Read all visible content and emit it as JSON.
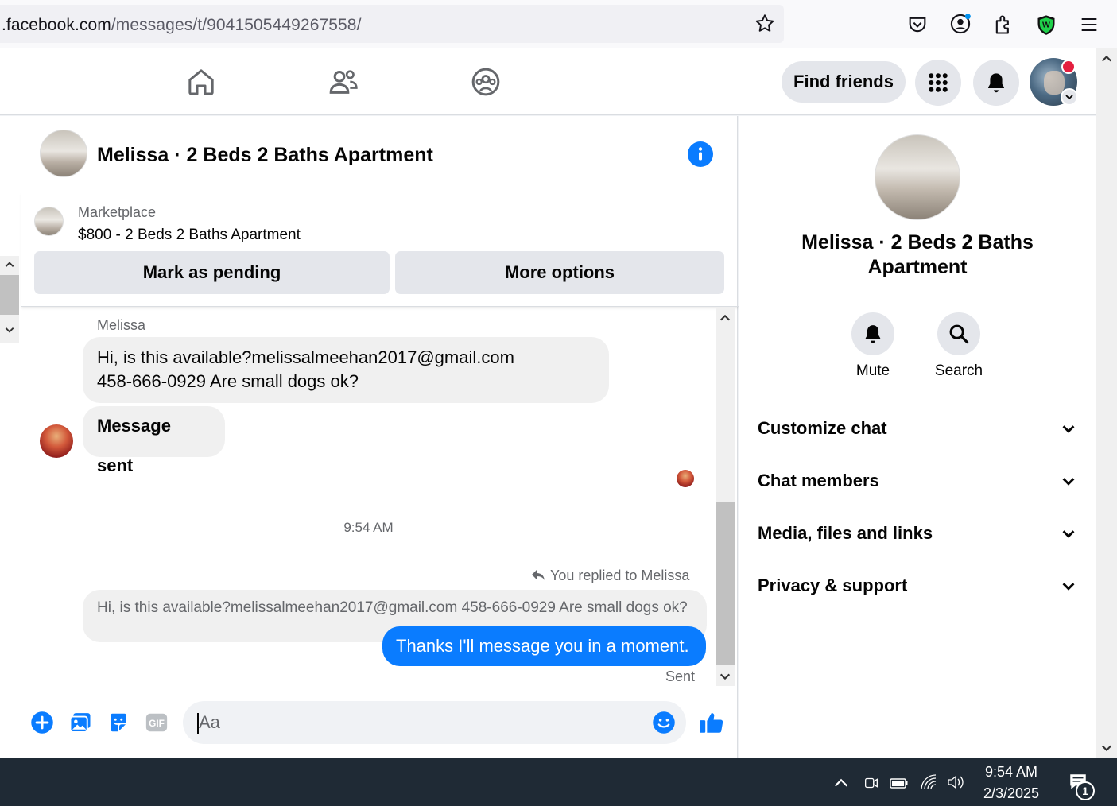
{
  "browser": {
    "url_host": ".facebook.com",
    "url_path": "/messages/t/9041505449267558/"
  },
  "nav": {
    "find_friends": "Find friends"
  },
  "chat": {
    "title": "Melissa · 2 Beds 2 Baths Apartment",
    "marketplace_label": "Marketplace",
    "listing": "$800 - 2 Beds 2 Baths Apartment",
    "mark_pending": "Mark as pending",
    "more_options": "More options",
    "sender_name": "Melissa",
    "msg1_line1": "Hi, is this available?melissalmeehan2017@gmail.com",
    "msg1_line2": "458-666-0929 Are small dogs ok?",
    "msg2": "Message sent",
    "timestamp": "9:54 AM",
    "replied_to": "You replied to Melissa",
    "quoted": "Hi, is this available?melissalmeehan2017@gmail.com 458-666-0929 Are small dogs ok?",
    "my_reply": "Thanks I'll message you in a moment.",
    "status": "Sent",
    "composer_placeholder": "Aa",
    "accent": "#0a7cff"
  },
  "info": {
    "title_line1": "Melissa · 2 Beds 2 Baths",
    "title_line2": "Apartment",
    "mute": "Mute",
    "search": "Search",
    "sections": [
      "Customize chat",
      "Chat members",
      "Media, files and links",
      "Privacy & support"
    ]
  },
  "taskbar": {
    "time": "9:54 AM",
    "date": "2/3/2025",
    "notif_count": "1"
  }
}
